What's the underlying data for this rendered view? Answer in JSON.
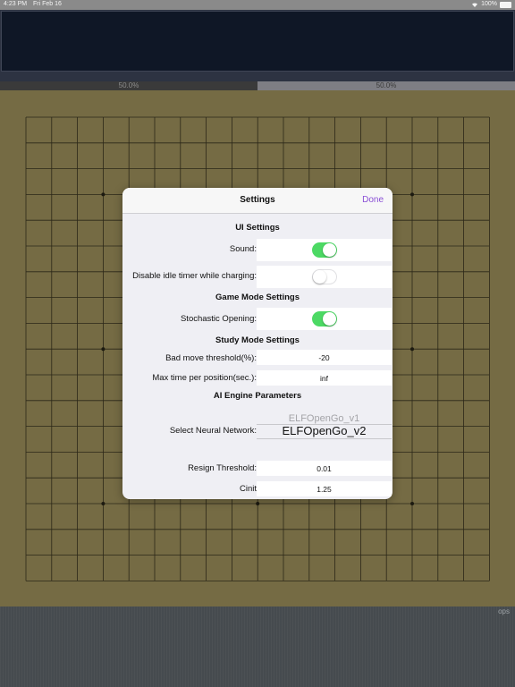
{
  "status_bar": {
    "time": "4:23 PM",
    "date": "Fri Feb 16",
    "battery": "100%"
  },
  "win_rate": {
    "black_label": "50.0%",
    "white_label": "50.0%",
    "black_fraction": 0.5
  },
  "bottom": {
    "label": "ops"
  },
  "settings": {
    "title": "Settings",
    "done_label": "Done",
    "ui_section": "UI Settings",
    "sound_label": "Sound:",
    "sound_on": true,
    "idle_label": "Disable idle timer while charging:",
    "idle_on": false,
    "game_section": "Game Mode Settings",
    "stochastic_label": "Stochastic Opening:",
    "stochastic_on": true,
    "study_section": "Study Mode Settings",
    "bad_move_label": "Bad move threshold(%):",
    "bad_move_value": "-20",
    "max_time_label": "Max time per position(sec.):",
    "max_time_value": "inf",
    "ai_section": "AI Engine Parameters",
    "network_label": "Select Neural Network:",
    "network_options": [
      "ELFOpenGo_v1",
      "ELFOpenGo_v2"
    ],
    "network_selected": "ELFOpenGo_v2",
    "resign_label": "Resign Threshold:",
    "resign_value": "0.01",
    "cinit_label": "Cinit",
    "cinit_value": "1.25"
  },
  "colors": {
    "accent": "#8a4fd6",
    "toggle_on": "#4cd964",
    "board": "#756b44"
  },
  "board": {
    "size": 19
  }
}
